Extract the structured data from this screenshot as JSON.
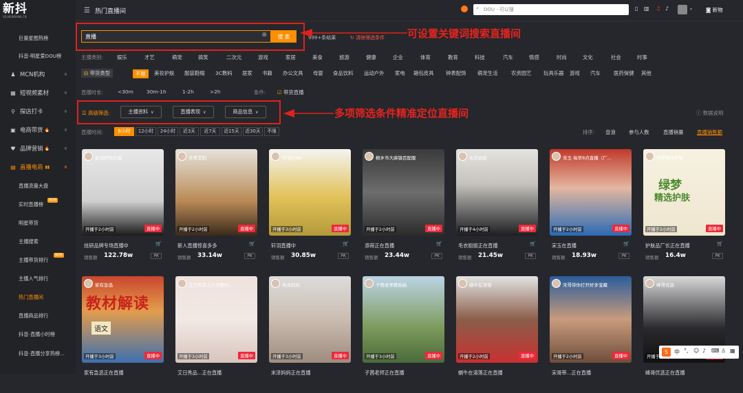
{
  "app": {
    "logo": "新抖",
    "logo_sub": "XD.NEWRANK.CN",
    "breadcrumb": "热门直播间"
  },
  "sidebar": {
    "items": [
      {
        "label": "巨量星图热榜",
        "type": "sub"
      },
      {
        "label": "抖音-明星爱DOU榜",
        "type": "sub"
      },
      {
        "label": "MCN机构",
        "icon": "♟"
      },
      {
        "label": "短视频素材",
        "icon": "▦"
      },
      {
        "label": "探店打卡",
        "icon": "⚲"
      },
      {
        "label": "电商带货",
        "icon": "▣",
        "hot": "🔥"
      },
      {
        "label": "品牌营销",
        "icon": "♥",
        "hot": "🔥"
      },
      {
        "label": "直播电商",
        "icon": "▤",
        "active": true
      }
    ],
    "subs": [
      "直播流量大盘",
      "实时直播榜",
      "明星带货",
      "主播搜索",
      "主播带货排行",
      "主播人气排行",
      "热门直播间",
      "直播商品排行",
      "抖音-直播小时榜",
      "抖音-直播分享热榜..."
    ],
    "new_badge": "NEW"
  },
  "header": {
    "search_placeholder": "DOU · 可以搜",
    "new_label": "新物"
  },
  "search": {
    "value": "直播",
    "button": "搜 索",
    "result_count": "999+条结果",
    "clear_filters": "清除筛选条件"
  },
  "annotations": {
    "a1": "可设置关键词搜索直播间",
    "a2": "多项筛选条件精准定位直播间"
  },
  "filters": {
    "category_label": "主播类别:",
    "categories": [
      "娱乐",
      "才艺",
      "萌宠",
      "搞笑",
      "二次元",
      "游戏",
      "家居",
      "美食",
      "旅游",
      "健康",
      "企业",
      "体育",
      "教育",
      "科技",
      "汽车",
      "情感",
      "时尚",
      "文化",
      "社会",
      "时事"
    ],
    "goods_label": "带货类型",
    "goods": [
      "不限",
      "美妆护肤",
      "服装鞋帽",
      "3C数码",
      "居家",
      "书籍",
      "办公文具",
      "母婴",
      "食品饮料",
      "运动户外",
      "家电",
      "箱包皮具",
      "钟表配饰",
      "萌宠生活",
      "农资园艺",
      "玩具乐器",
      "游戏",
      "汽车",
      "医药保健",
      "其他"
    ],
    "duration_label": "直播时长:",
    "durations": [
      "<30m",
      "30m-1h",
      "1-2h",
      ">2h"
    ],
    "condition_label": "条件:",
    "condition": "带货直播",
    "advanced_label": "高级筛选:",
    "dropdowns": [
      "主播资料",
      "直播表现",
      "商品信息"
    ],
    "data_note": "数据说明",
    "time_label": "直播时间:",
    "times": [
      "6小时",
      "12小时",
      "24小时",
      "近3天",
      "近7天",
      "近15天",
      "近30天",
      "不限"
    ],
    "sort_label": "排序:",
    "sorts": [
      "音浪",
      "参与人数",
      "直播销量",
      "直播销售额"
    ]
  },
  "cards": [
    {
      "title": "星线好物分选",
      "name": "炫研品牌专场直播中",
      "start": "开播于2小时前",
      "live": "直播中",
      "sale_label": "销售额",
      "sale": "122.78w"
    },
    {
      "title": "芳青定制",
      "name": "新人直播惊喜多多",
      "start": "开播于2小时前",
      "live": "直播中",
      "sale_label": "销售额",
      "sale": "33.14w"
    },
    {
      "title": "轩羽JDND",
      "name": "轩羽直播中",
      "start": "开播于3小时前",
      "live": "直播中",
      "sale_label": "销售额",
      "sale": "30.85w"
    },
    {
      "title": "桐乡市大麻镇百配服",
      "name": "添荷正在直播",
      "start": "开播于2小时前",
      "live": "直播中",
      "sale_label": "销售额",
      "sale": "23.44w"
    },
    {
      "title": "毛衣姐姐",
      "name": "毛衣姐姐正在直播",
      "start": "开播于4小时前",
      "live": "直播中",
      "sale_label": "销售额",
      "sale": "21.45w"
    },
    {
      "title": "宋玉 每早8点直播（厂...",
      "name": "宋玉在直播",
      "start": "开播于2小时前",
      "live": "直播中",
      "sale_label": "销售额",
      "sale": "18.93w"
    },
    {
      "title": "绿梦精选护肤",
      "name": "护肤品厂长正在直播",
      "start": "开播于2小时前",
      "live": "直播中",
      "sale_label": "销售额",
      "sale": "16.4w"
    },
    {
      "title": "家有急选",
      "name": "家有急选正在直播",
      "start": "开播于3小时前",
      "live": "直播中"
    },
    {
      "title": "艾日秀早上七点整时...",
      "name": "艾日秀品...正在直播",
      "start": "开播于3小时前",
      "live": "直播中"
    },
    {
      "title": "米泽妈妈",
      "name": "米泽妈妈正在直播",
      "start": "开播于3小时前",
      "live": "直播中"
    },
    {
      "title": "子茜老师教拍拍",
      "name": "子茜老师正在直播",
      "start": "开播于3小时前",
      "live": "直播中"
    },
    {
      "title": "蜗牛在溶落",
      "name": "蜗牛在溶落正在直播",
      "start": "开播于2小时前",
      "live": "直播中"
    },
    {
      "title": "宋哥带你打开好多宝藏",
      "name": "宋哥带...正在直播",
      "start": "开播于2小时前",
      "live": "直播中"
    },
    {
      "title": "峰哥优选",
      "name": "峰哥优选正在直播",
      "start": "开播于4小时前",
      "live": "直播中"
    }
  ],
  "thumb_texts": {
    "t7a": "绿梦",
    "t7b": "精选护肤",
    "t8a": "教材解读",
    "t8b": "语文"
  },
  "ime": {
    "s": "S",
    "zh": "中"
  }
}
